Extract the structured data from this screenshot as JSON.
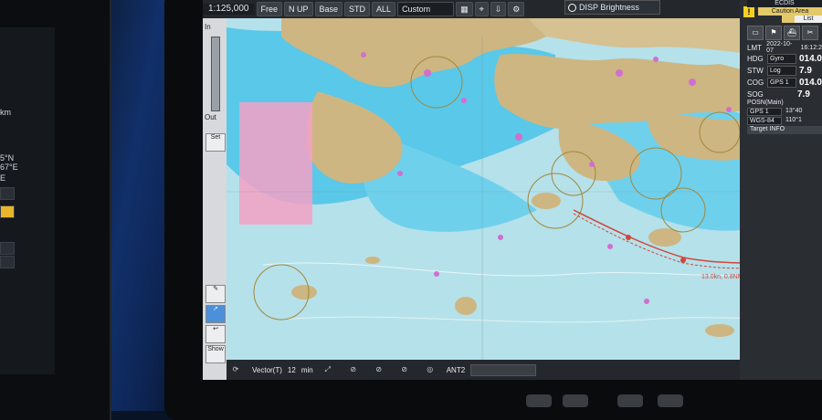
{
  "left_device": {
    "rows": [
      "km",
      "5°N",
      "67°E",
      "E"
    ]
  },
  "topbar": {
    "scale": "1:125,000",
    "free_label": "Free",
    "orientation_label": "N UP",
    "base_label": "Base",
    "std_label": "STD",
    "all_label": "ALL",
    "custom_label": "Custom"
  },
  "disp_brightness": "DISP Brightness",
  "left_toolbar": {
    "in_label": "In",
    "out_label": "Out",
    "set_label": "Set",
    "show_label": "Show"
  },
  "right_panel": {
    "ecdis_label": "ECDIS",
    "caution_label": "Caution Area",
    "list_label": "List",
    "lmt_label": "LMT",
    "lmt_value": "2022-10-07",
    "lmt_time": "16:12:2",
    "hdg_label": "HDG",
    "hdg_source": "Gyro",
    "hdg_value": "014.0",
    "stw_label": "STW",
    "stw_source": "Log",
    "stw_value": "7.9",
    "cog_label": "COG",
    "cog_source": "GPS 1",
    "cog_value": "014.0",
    "sog_label": "SOG",
    "sog_value": "7.9",
    "posn_label": "POSN(Main)",
    "posn_source": "GPS 1",
    "posn_lat": "13°40",
    "datum": "WGS-84",
    "posn_lon": "110°1",
    "target_label": "Target INFO"
  },
  "bottombar": {
    "vector_label": "Vector(T)",
    "vector_value": "12",
    "vector_unit": "min",
    "ant_label": "ANT2"
  },
  "map": {
    "annotation": "13.0kn, 0.8NM"
  },
  "colors": {
    "land": "#cdb682",
    "shallow": "#5ac8e8",
    "deep": "#b5e1ea",
    "magenta": "#d26ed0",
    "danger": "#f3a1c5",
    "track": "#d0463c"
  }
}
